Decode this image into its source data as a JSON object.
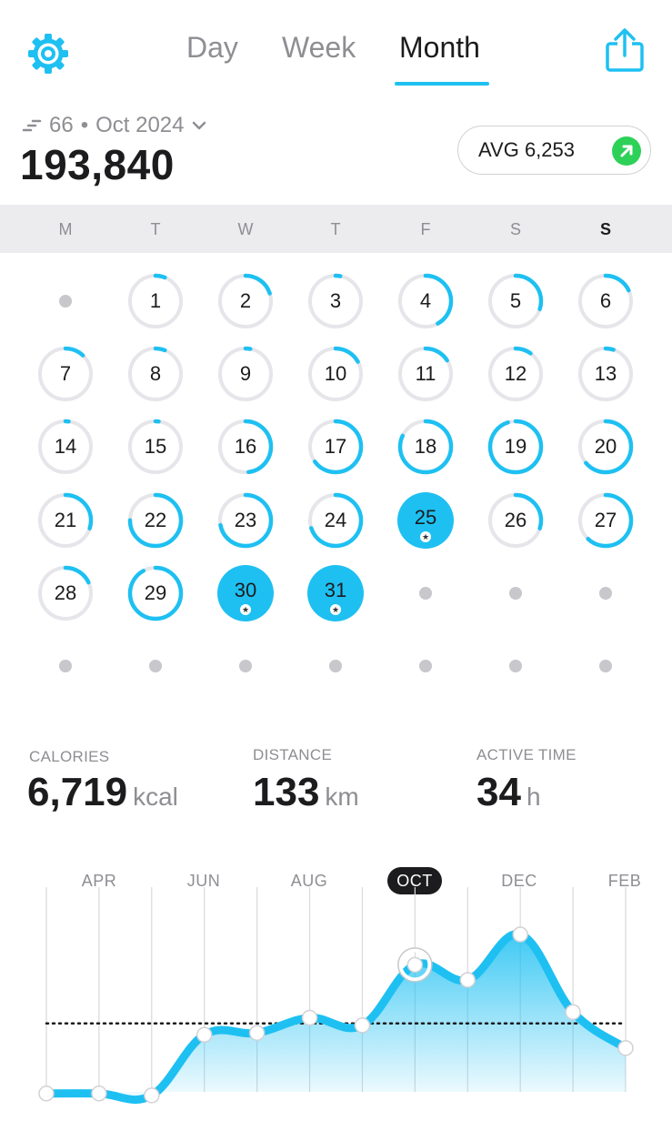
{
  "header": {
    "tabs": [
      {
        "label": "Day",
        "active": false
      },
      {
        "label": "Week",
        "active": false
      },
      {
        "label": "Month",
        "active": true
      }
    ],
    "settings_icon": "gear-icon",
    "share_icon": "share-icon",
    "accent_color": "#1ec0f2"
  },
  "summary": {
    "count": "66",
    "period": "Oct 2024",
    "separator": "•",
    "total": "193,840",
    "avg_label": "AVG 6,253",
    "avg_trend_icon": "arrow-up-right-icon",
    "trend_color": "#2ed158"
  },
  "calendar": {
    "weekdays": [
      "M",
      "T",
      "W",
      "T",
      "F",
      "S",
      "S"
    ],
    "days": [
      {
        "day": "1",
        "progress": 0.06
      },
      {
        "day": "2",
        "progress": 0.2
      },
      {
        "day": "3",
        "progress": 0.03
      },
      {
        "day": "4",
        "progress": 0.42
      },
      {
        "day": "5",
        "progress": 0.3
      },
      {
        "day": "6",
        "progress": 0.18
      },
      {
        "day": "7",
        "progress": 0.12
      },
      {
        "day": "8",
        "progress": 0.06
      },
      {
        "day": "9",
        "progress": 0.03
      },
      {
        "day": "10",
        "progress": 0.17
      },
      {
        "day": "11",
        "progress": 0.16
      },
      {
        "day": "12",
        "progress": 0.1
      },
      {
        "day": "13",
        "progress": 0.05
      },
      {
        "day": "14",
        "progress": 0.02
      },
      {
        "day": "15",
        "progress": 0.02
      },
      {
        "day": "16",
        "progress": 0.48
      },
      {
        "day": "17",
        "progress": 0.65
      },
      {
        "day": "18",
        "progress": 0.82
      },
      {
        "day": "19",
        "progress": 0.95
      },
      {
        "day": "20",
        "progress": 0.64
      },
      {
        "day": "21",
        "progress": 0.3
      },
      {
        "day": "22",
        "progress": 0.75
      },
      {
        "day": "23",
        "progress": 0.72
      },
      {
        "day": "24",
        "progress": 0.7
      },
      {
        "day": "25",
        "progress": 1.0,
        "goal_met": true,
        "badge": "★"
      },
      {
        "day": "26",
        "progress": 0.3
      },
      {
        "day": "27",
        "progress": 0.62
      },
      {
        "day": "28",
        "progress": 0.18
      },
      {
        "day": "29",
        "progress": 0.92
      },
      {
        "day": "30",
        "progress": 1.0,
        "goal_met": true,
        "badge": "★"
      },
      {
        "day": "31",
        "progress": 1.0,
        "goal_met": true,
        "badge": "★"
      }
    ],
    "ring_track_color": "#e5e5ea"
  },
  "stats": {
    "calories": {
      "label": "CALORIES",
      "value": "6,719",
      "unit": "kcal"
    },
    "distance": {
      "label": "DISTANCE",
      "value": "133",
      "unit": "km"
    },
    "active_time": {
      "label": "ACTIVE TIME",
      "value": "34",
      "unit": "h"
    }
  },
  "chart_data": {
    "type": "area",
    "x_labels": [
      "APR",
      "JUN",
      "AUG",
      "OCT",
      "DEC",
      "FEB"
    ],
    "selected_label": "OCT",
    "values": [
      0.03,
      0.03,
      0.02,
      0.34,
      0.35,
      0.43,
      0.39,
      0.71,
      0.63,
      0.87,
      0.46,
      0.27
    ],
    "average_line": 0.4,
    "selected_index": 7,
    "line_color": "#1ec0f2"
  }
}
